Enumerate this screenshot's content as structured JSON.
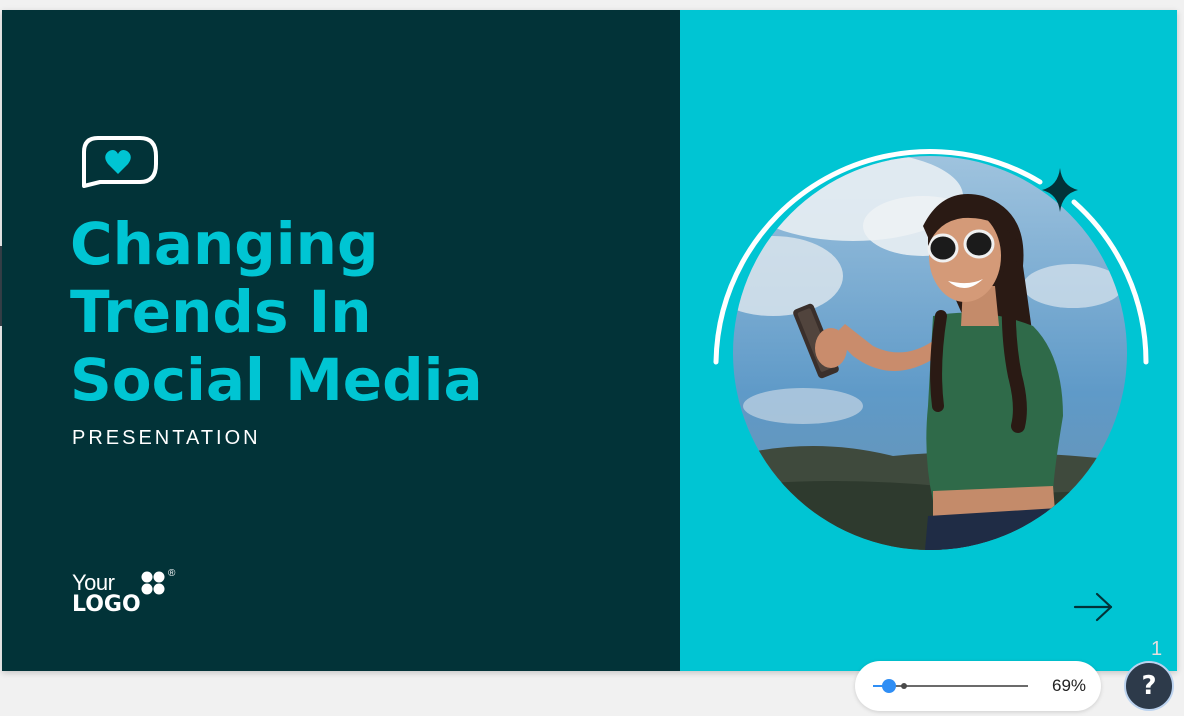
{
  "slide": {
    "title_lines": [
      "Changing",
      "Trends In",
      "Social Media"
    ],
    "subtitle": "PRESENTATION",
    "logo": {
      "line1": "Your",
      "line2": "LOGO",
      "registered_mark": "®"
    },
    "page_number": "1",
    "colors": {
      "dark_panel": "#023338",
      "accent_teal": "#00c5d3",
      "text_white": "#ffffff"
    },
    "icons": {
      "speech": "speech-bubble-heart-icon",
      "sparkle": "sparkle-star-icon",
      "next": "arrow-right-icon",
      "logo_mark": "four-petal-logo-icon"
    }
  },
  "zoom": {
    "value_label": "69%",
    "level_fraction": 0.1
  },
  "help": {
    "label": "?"
  }
}
